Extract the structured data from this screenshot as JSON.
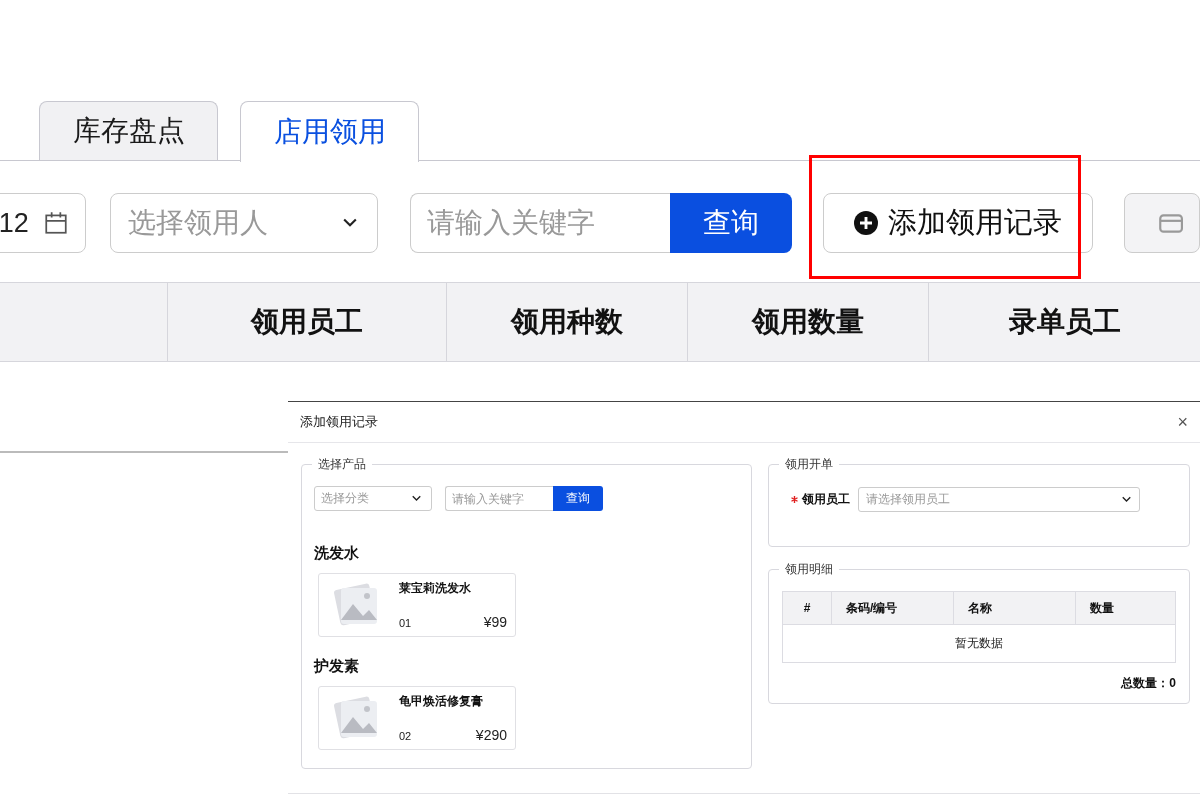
{
  "tabs": [
    {
      "label": "库存盘点",
      "selected": false
    },
    {
      "label": "店用领用",
      "selected": true
    }
  ],
  "toolbar": {
    "date_value": "12",
    "person_select": {
      "placeholder": "选择领用人"
    },
    "search": {
      "placeholder": "请输入关键字"
    },
    "search_button": "查询",
    "add_button": "添加领用记录",
    "highlighted": true
  },
  "table": {
    "columns": [
      "",
      "领用员工",
      "领用种数",
      "领用数量",
      "录单员工"
    ]
  },
  "dialog": {
    "title": "添加领用记录",
    "close": "×",
    "products": {
      "legend": "选择产品",
      "category_select": {
        "placeholder": "选择分类"
      },
      "search": {
        "placeholder": "请输入关键字"
      },
      "search_button": "查询",
      "groups": [
        {
          "name": "洗发水",
          "items": [
            {
              "name": "莱宝莉洗发水",
              "code": "01",
              "price": "¥99"
            }
          ]
        },
        {
          "name": "护发素",
          "items": [
            {
              "name": "龟甲焕活修复膏",
              "code": "02",
              "price": "¥290"
            }
          ]
        }
      ]
    },
    "order": {
      "legend": "领用开单",
      "employee_label": "领用员工",
      "required": true,
      "employee_select": {
        "placeholder": "请选择领用员工"
      }
    },
    "detail": {
      "legend": "领用明细",
      "columns": [
        "#",
        "条码/编号",
        "名称",
        "数量"
      ],
      "empty_text": "暂无数据",
      "total": "总数量：0"
    }
  }
}
